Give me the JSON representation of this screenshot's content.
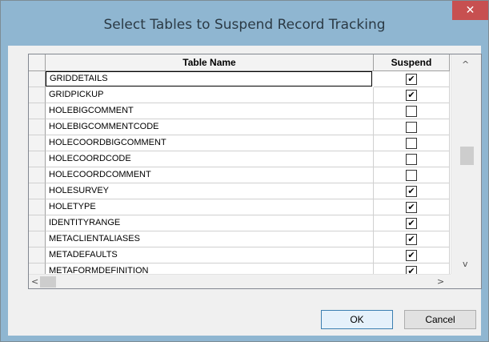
{
  "dialog": {
    "title": "Select Tables to Suspend Record Tracking",
    "close_glyph": "✕"
  },
  "grid": {
    "columns": {
      "name": "Table Name",
      "suspend": "Suspend"
    },
    "rows": [
      {
        "name": "GRIDDETAILS",
        "suspend": true
      },
      {
        "name": "GRIDPICKUP",
        "suspend": true
      },
      {
        "name": "HOLEBIGCOMMENT",
        "suspend": false
      },
      {
        "name": "HOLEBIGCOMMENTCODE",
        "suspend": false
      },
      {
        "name": "HOLECOORDBIGCOMMENT",
        "suspend": false
      },
      {
        "name": "HOLECOORDCODE",
        "suspend": false
      },
      {
        "name": "HOLECOORDCOMMENT",
        "suspend": false
      },
      {
        "name": "HOLESURVEY",
        "suspend": true
      },
      {
        "name": "HOLETYPE",
        "suspend": true
      },
      {
        "name": "IDENTITYRANGE",
        "suspend": true
      },
      {
        "name": "METACLIENTALIASES",
        "suspend": true
      },
      {
        "name": "METADEFAULTS",
        "suspend": true
      },
      {
        "name": "METAFORMDEFINITION",
        "suspend": true
      }
    ],
    "check_glyph": "✔",
    "scroll": {
      "up": "^",
      "down": "v",
      "left": "<",
      "right": ">"
    }
  },
  "buttons": {
    "ok": "OK",
    "cancel": "Cancel"
  },
  "colors": {
    "title_bar": "#8fb6d1",
    "close": "#c75050",
    "client": "#f0f0f0"
  }
}
